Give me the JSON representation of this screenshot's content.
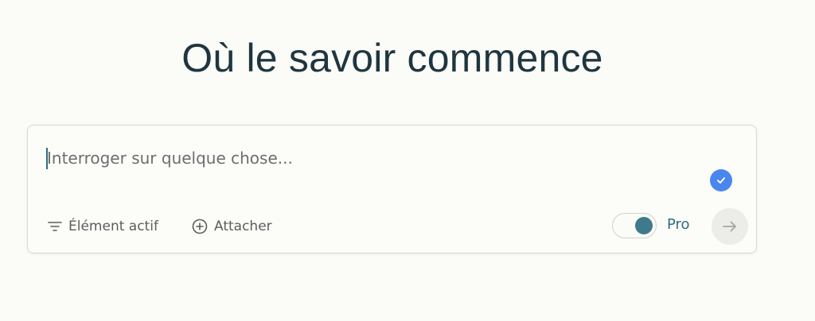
{
  "header": {
    "title": "Où le savoir commence"
  },
  "search": {
    "value": "",
    "placeholder": "Interroger sur quelque chose...",
    "badge_icon": "check-circle-icon",
    "badge_color": "#4a86f0"
  },
  "toolbar": {
    "focus_label": "Élément actif",
    "focus_icon": "filter-lines-icon",
    "attach_label": "Attacher",
    "attach_icon": "plus-circle-icon",
    "pro_label": "Pro",
    "pro_enabled": true,
    "pro_color": "#3e7a8c",
    "submit_icon": "arrow-right-icon"
  }
}
